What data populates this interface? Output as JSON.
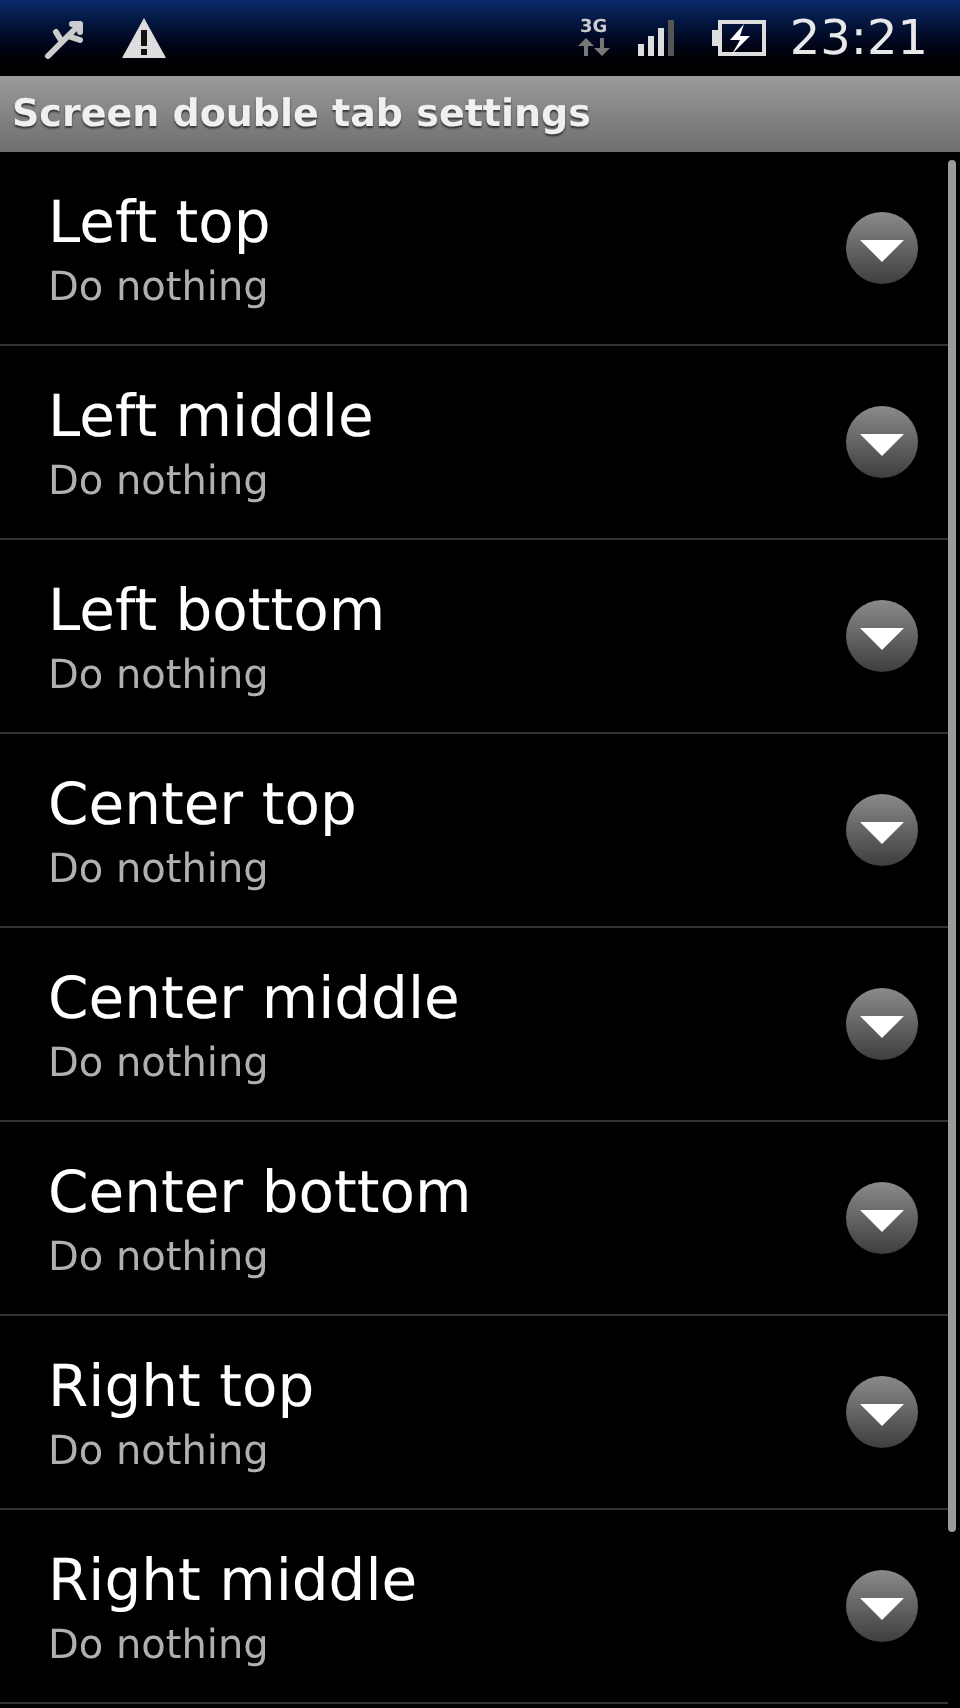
{
  "status_bar": {
    "network": "3G",
    "time": "23:21"
  },
  "title": "Screen double tab settings",
  "items": [
    {
      "label": "Left top",
      "value": "Do nothing"
    },
    {
      "label": "Left middle",
      "value": "Do nothing"
    },
    {
      "label": "Left bottom",
      "value": "Do nothing"
    },
    {
      "label": "Center top",
      "value": "Do nothing"
    },
    {
      "label": "Center middle",
      "value": "Do nothing"
    },
    {
      "label": "Center bottom",
      "value": "Do nothing"
    },
    {
      "label": "Right top",
      "value": "Do nothing"
    },
    {
      "label": "Right middle",
      "value": "Do nothing"
    }
  ]
}
